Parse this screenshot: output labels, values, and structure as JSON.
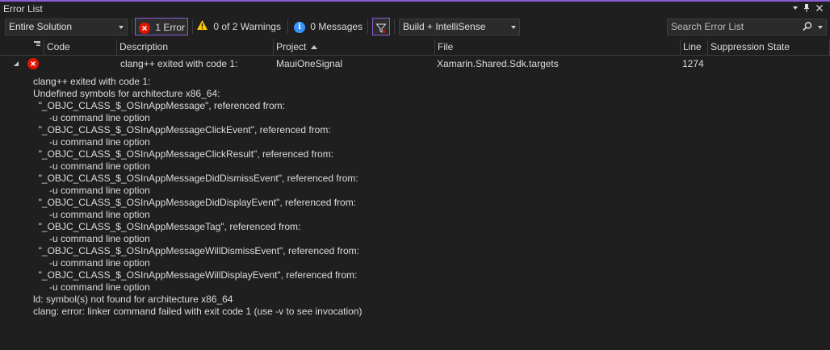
{
  "window": {
    "title": "Error List"
  },
  "toolbar": {
    "scope": "Entire Solution",
    "errors_label": "1 Error",
    "warnings_label": "0 of 2 Warnings",
    "messages_label": "0 Messages",
    "build_filter": "Build + IntelliSense",
    "search_placeholder": "Search Error List"
  },
  "columns": {
    "code": "Code",
    "description": "Description",
    "project": "Project",
    "file": "File",
    "line": "Line",
    "suppression": "Suppression State"
  },
  "row": {
    "severity": "error",
    "code": "",
    "description": "clang++ exited with code 1:",
    "project": "MauiOneSignal",
    "file": "Xamarin.Shared.Sdk.targets",
    "line": "1274",
    "suppression": ""
  },
  "details": [
    "clang++ exited with code 1:",
    "Undefined symbols for architecture x86_64:",
    "  \"_OBJC_CLASS_$_OSInAppMessage\", referenced from:",
    "      -u command line option",
    "  \"_OBJC_CLASS_$_OSInAppMessageClickEvent\", referenced from:",
    "      -u command line option",
    "  \"_OBJC_CLASS_$_OSInAppMessageClickResult\", referenced from:",
    "      -u command line option",
    "  \"_OBJC_CLASS_$_OSInAppMessageDidDismissEvent\", referenced from:",
    "      -u command line option",
    "  \"_OBJC_CLASS_$_OSInAppMessageDidDisplayEvent\", referenced from:",
    "      -u command line option",
    "  \"_OBJC_CLASS_$_OSInAppMessageTag\", referenced from:",
    "      -u command line option",
    "  \"_OBJC_CLASS_$_OSInAppMessageWillDismissEvent\", referenced from:",
    "      -u command line option",
    "  \"_OBJC_CLASS_$_OSInAppMessageWillDisplayEvent\", referenced from:",
    "      -u command line option",
    "ld: symbol(s) not found for architecture x86_64",
    "clang: error: linker command failed with exit code 1 (use -v to see invocation)"
  ],
  "colors": {
    "accent": "#8a5cd6",
    "error": "#e51400",
    "warning": "#ffcc00",
    "info": "#3794ff",
    "background": "#1f1f1f"
  },
  "icons": [
    "dropdown-icon",
    "pin-icon",
    "close-icon",
    "error-icon",
    "warning-icon",
    "info-icon",
    "filter-icon",
    "search-icon",
    "expander-icon"
  ]
}
